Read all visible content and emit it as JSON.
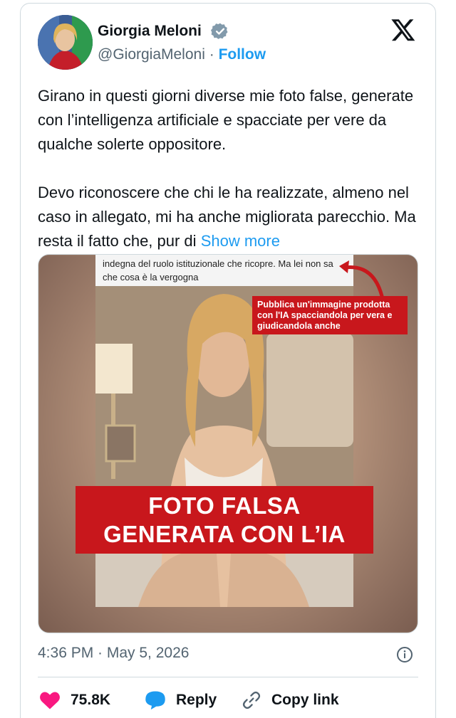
{
  "author": {
    "name": "Giorgia Meloni",
    "handle": "@GiorgiaMeloni",
    "separator": " · ",
    "follow_label": "Follow"
  },
  "tweet": {
    "paragraph1": "Girano in questi giorni diverse mie foto false, generate con l’intelligenza artificiale e spacciate per vere da qualche solerte oppositore.",
    "paragraph2": "Devo riconoscere che chi le ha realizzate, almeno nel caso in allegato, mi ha anche migliorata parecchio. Ma resta il fatto che, pur di",
    "show_more": "Show more"
  },
  "media": {
    "quote_text": "indegna del ruolo istituzionale che ricopre. Ma lei non sa che cosa è la vergogna",
    "callout_text": "Pubblica un'immagine prodotta con l'IA spacciandola per vera e giudicandola anche",
    "banner_line1": "FOTO FALSA",
    "banner_line2": "GENERATA CON L’IA"
  },
  "meta": {
    "timestamp": "4:36 PM · May 5, 2026"
  },
  "actions": {
    "likes_count": "75.8K",
    "reply_label": "Reply",
    "copy_link_label": "Copy link"
  },
  "colors": {
    "accent": "#1d9bf0",
    "like": "#f91880",
    "banner_red": "#c8171c",
    "text": "#0f1419",
    "muted": "#536471"
  }
}
